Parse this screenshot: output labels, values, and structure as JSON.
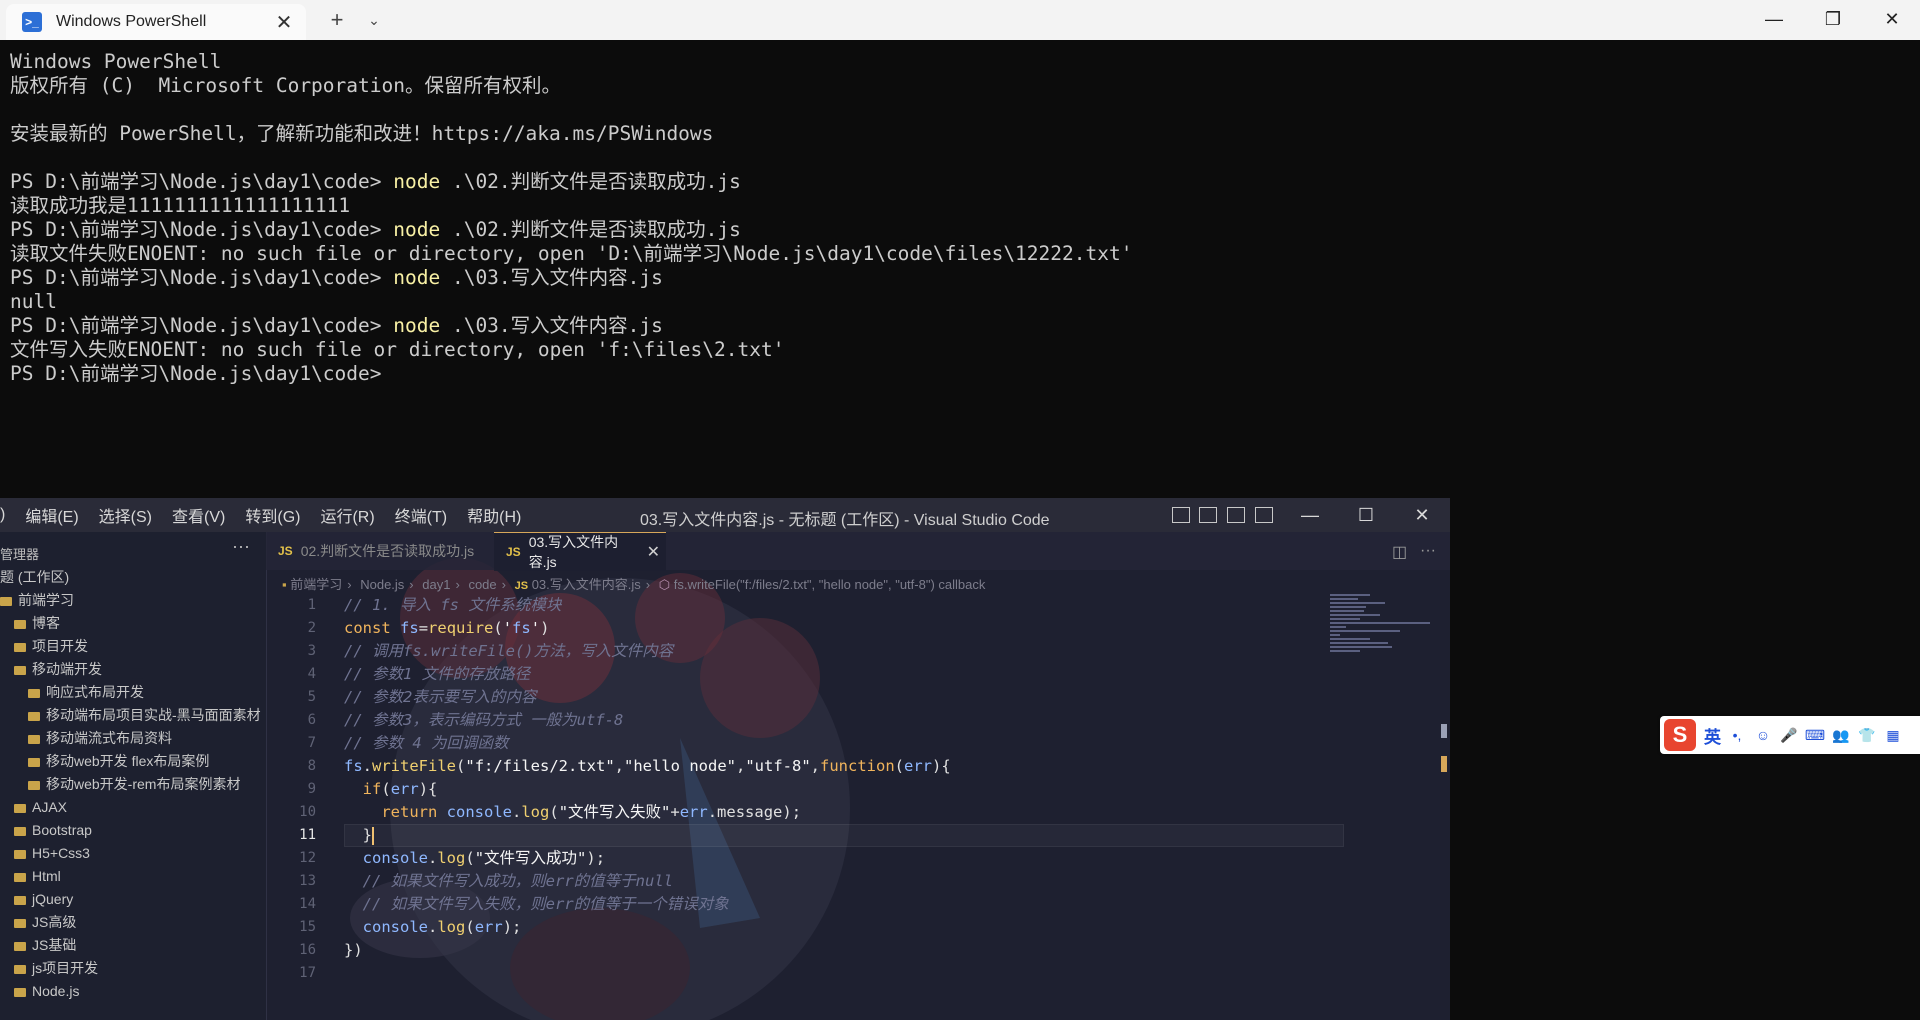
{
  "powershell": {
    "tab_title": "Windows PowerShell",
    "lines": [
      {
        "prompt": "Windows PowerShell",
        "cmd": ""
      },
      {
        "prompt": "版权所有 (C)  Microsoft Corporation。保留所有权利。",
        "cmd": ""
      },
      {
        "prompt": "",
        "cmd": ""
      },
      {
        "prompt": "安装最新的 PowerShell，了解新功能和改进！https://aka.ms/PSWindows",
        "cmd": ""
      },
      {
        "prompt": "",
        "cmd": ""
      },
      {
        "prompt": "PS D:\\前端学习\\Node.js\\day1\\code> ",
        "cmd": "node",
        "args": " .\\02.判断文件是否读取成功.js"
      },
      {
        "prompt": "读取成功我是1111111111111111111",
        "cmd": ""
      },
      {
        "prompt": "PS D:\\前端学习\\Node.js\\day1\\code> ",
        "cmd": "node",
        "args": " .\\02.判断文件是否读取成功.js"
      },
      {
        "prompt": "读取文件失败ENOENT: no such file or directory, open 'D:\\前端学习\\Node.js\\day1\\code\\files\\12222.txt'",
        "cmd": ""
      },
      {
        "prompt": "PS D:\\前端学习\\Node.js\\day1\\code> ",
        "cmd": "node",
        "args": " .\\03.写入文件内容.js"
      },
      {
        "prompt": "null",
        "cmd": ""
      },
      {
        "prompt": "PS D:\\前端学习\\Node.js\\day1\\code> ",
        "cmd": "node",
        "args": " .\\03.写入文件内容.js"
      },
      {
        "prompt": "文件写入失败ENOENT: no such file or directory, open 'f:\\files\\2.txt'",
        "cmd": ""
      },
      {
        "prompt": "PS D:\\前端学习\\Node.js\\day1\\code>",
        "cmd": ""
      }
    ],
    "colors": {
      "background": "#0c0c0c",
      "text": "#cccccc",
      "command": "#f9f1a5"
    }
  },
  "vscode": {
    "menu": [
      ")",
      "编辑(E)",
      "选择(S)",
      "查看(V)",
      "转到(G)",
      "运行(R)",
      "终端(T)",
      "帮助(H)"
    ],
    "title": "03.写入文件内容.js - 无标题 (工作区) - Visual Studio Code",
    "sidebar": {
      "header": "管理器",
      "workspace": "题 (工作区)",
      "items": [
        "前端学习",
        "博客",
        "项目开发",
        "移动端开发",
        "响应式布局开发",
        "移动端布局项目实战-黑马面面素材",
        "移动端流式布局资料",
        "移动web开发 flex布局案例",
        "移动web开发-rem布局案例素材",
        "AJAX",
        "Bootstrap",
        "H5+Css3",
        "Html",
        "jQuery",
        "JS高级",
        "JS基础",
        "js项目开发",
        "Node.js"
      ]
    },
    "tabs": [
      {
        "label": "02.判断文件是否读取成功.js",
        "badge": "JS"
      },
      {
        "label": "03.写入文件内容.js",
        "badge": "JS"
      }
    ],
    "breadcrumb": [
      "前端学习",
      "Node.js",
      "day1",
      "code",
      "03.写入文件内容.js",
      "fs.writeFile(\"f:/files/2.txt\", \"hello node\", \"utf-8\") callback"
    ],
    "code_lines": [
      "// 1. 导入 fs 文件系统模块",
      "const fs=require('fs')",
      "// 调用fs.writeFile()方法，写入文件内容",
      "// 参数1 文件的存放路径",
      "// 参数2表示要写入的内容",
      "// 参数3，表示编码方式 一般为utf-8",
      "// 参数 4 为回调函数",
      "fs.writeFile(\"f:/files/2.txt\",\"hello node\",\"utf-8\",function(err){",
      "  if(err){",
      "    return console.log(\"文件写入失败\"+err.message);",
      "  }",
      "  console.log(\"文件写入成功\");",
      "  // 如果文件写入成功，则err的值等于null",
      "  // 如果文件写入失败，则err的值等于一个错误对象",
      "  console.log(err);",
      "})",
      ""
    ],
    "current_line": 11,
    "colors": {
      "background": "#1e2030",
      "accent": "#d7a75a",
      "comment": "#6f7391",
      "keyword": "#f0b45c"
    }
  },
  "ime": {
    "lang": "英",
    "logo": "S"
  }
}
